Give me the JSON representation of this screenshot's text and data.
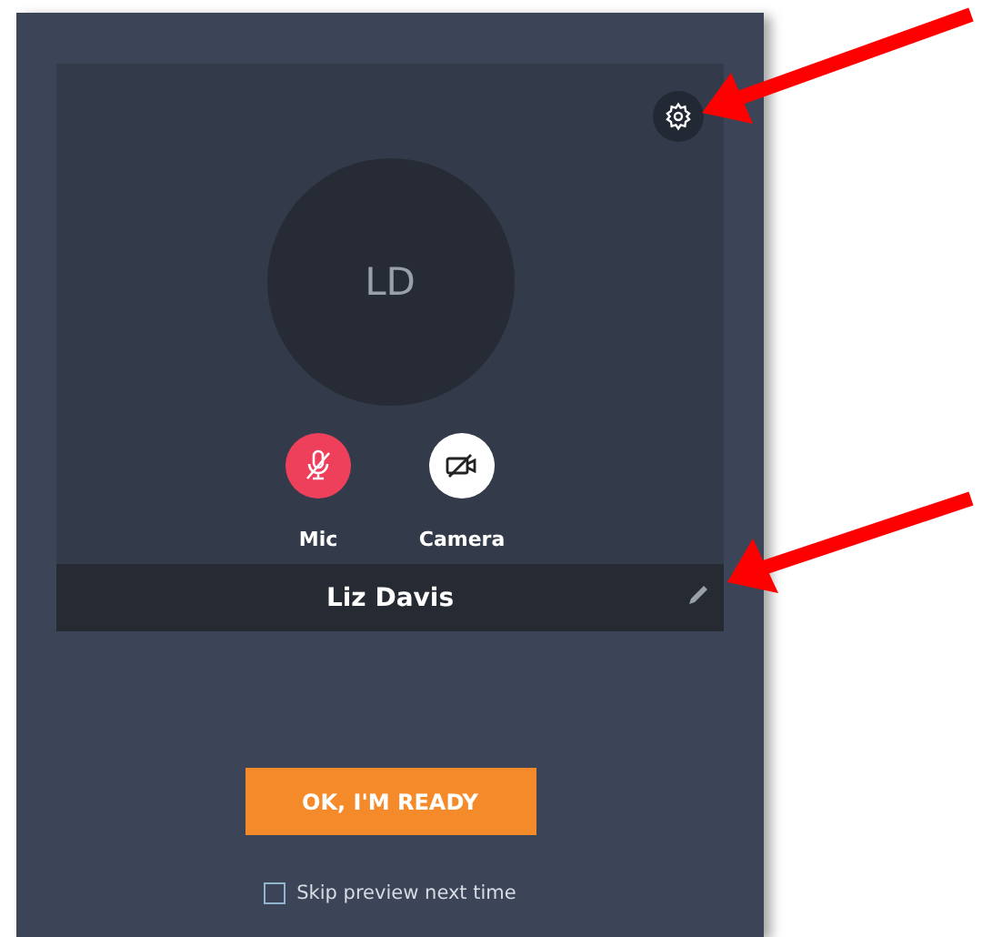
{
  "preview": {
    "avatar": {
      "initials": "LD"
    },
    "controls": [
      {
        "kind": "mic",
        "label": "Mic",
        "on": false
      },
      {
        "kind": "camera",
        "label": "Camera",
        "on": false
      }
    ],
    "name": "Liz Davis"
  },
  "ready_button": {
    "label": "OK, I'M READY"
  },
  "skip_preview": {
    "label": "Skip preview next time",
    "checked": false
  }
}
